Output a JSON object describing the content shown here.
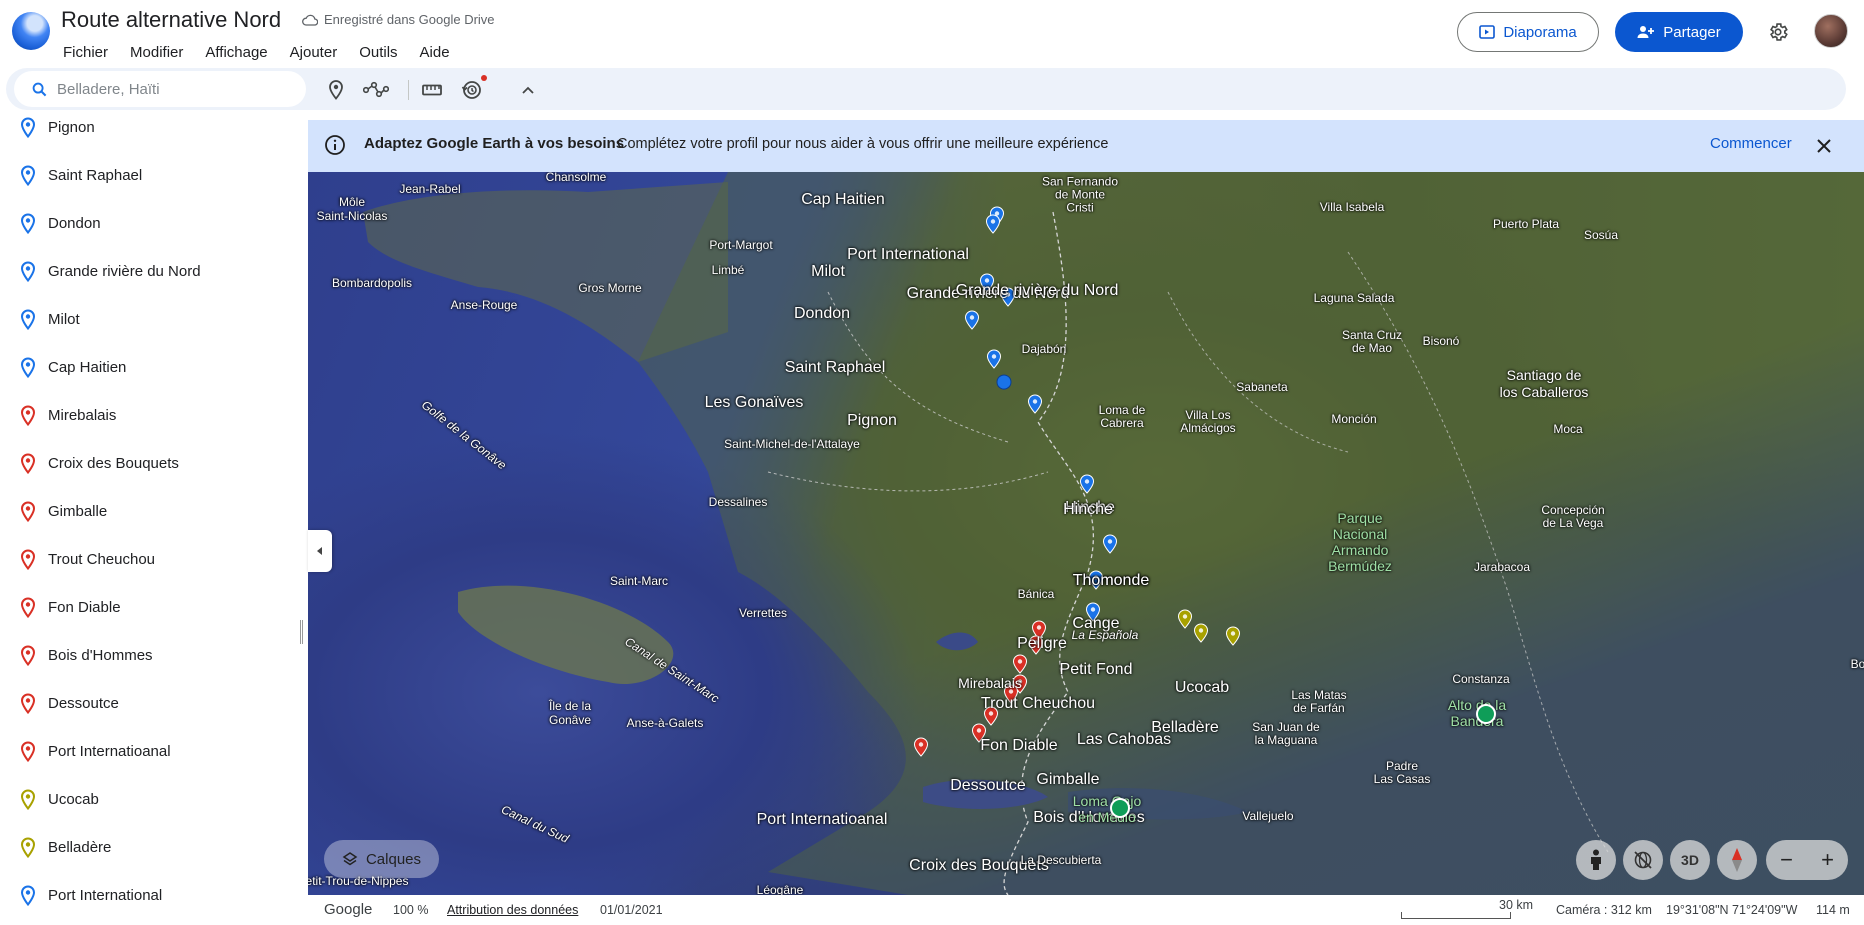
{
  "header": {
    "title": "Route alternative Nord",
    "drive_status": "Enregistré dans Google Drive",
    "menu": [
      "Fichier",
      "Modifier",
      "Affichage",
      "Ajouter",
      "Outils",
      "Aide"
    ],
    "slideshow_label": "Diaporama",
    "share_label": "Partager"
  },
  "toolbar": {
    "search_placeholder": "Belladere, Haïti"
  },
  "sidebar": {
    "items": [
      {
        "label": "Pignon",
        "color": "#1a73e8"
      },
      {
        "label": "Saint Raphael",
        "color": "#1a73e8"
      },
      {
        "label": "Dondon",
        "color": "#1a73e8"
      },
      {
        "label": "Grande rivière du Nord",
        "color": "#1a73e8"
      },
      {
        "label": "Milot",
        "color": "#1a73e8"
      },
      {
        "label": "Cap Haitien",
        "color": "#1a73e8"
      },
      {
        "label": "Mirebalais",
        "color": "#d93025"
      },
      {
        "label": "Croix des Bouquets",
        "color": "#d93025"
      },
      {
        "label": "Gimballe",
        "color": "#d93025"
      },
      {
        "label": "Trout Cheuchou",
        "color": "#d93025"
      },
      {
        "label": "Fon Diable",
        "color": "#d93025"
      },
      {
        "label": "Bois d'Hommes",
        "color": "#d93025"
      },
      {
        "label": "Dessoutce",
        "color": "#d93025"
      },
      {
        "label": "Port Internatioanal",
        "color": "#d93025"
      },
      {
        "label": "Ucocab",
        "color": "#a8a100"
      },
      {
        "label": "Belladère",
        "color": "#a8a100"
      },
      {
        "label": "Port International",
        "color": "#1a73e8"
      }
    ]
  },
  "banner": {
    "title": "Adaptez Google Earth à vos besoins",
    "text": "Complétez votre profil pour nous aider à vous offrir une meilleure expérience",
    "action": "Commencer"
  },
  "map": {
    "labels": {
      "jean_rabel": "Jean-Rabel",
      "mole": "Môle\nSaint-Nicolas",
      "chansolme": "Chansolme",
      "bombardopolis": "Bombardopolis",
      "anse_rouge": "Anse-Rouge",
      "gros_morne": "Gros Morne",
      "port_margot": "Port-Margot",
      "limbe": "Limbé",
      "cap_haitien": "Cap Haitien",
      "port_international": "Port International",
      "milot": "Milot",
      "grande_riviere": "Grande rivière du Nord",
      "dondon": "Dondon",
      "saint_raphael": "Saint Raphael",
      "pignon": "Pignon",
      "les_gonaives": "Les Gonaïves",
      "golfe_gonave": "Golfe de la Gonâve",
      "saint_michel": "Saint-Michel-de-l'Attalaye",
      "dessalines": "Dessalines",
      "hinche": "Hinche",
      "thomonde": "Thomonde",
      "saint_marc": "Saint-Marc",
      "verrettes": "Verrettes",
      "cange": "Cange",
      "peligre": "Peligre",
      "petit_fond": "Petit Fond",
      "mirebalais": "Mirebalais",
      "trout_cheuchou": "Trout Cheuchou",
      "ucocab": "Ucocab",
      "belladere": "Belladère",
      "las_cahobas": "Las Cahobas",
      "fon_diable": "Fon Diable",
      "dessoutce": "Dessoutce",
      "gimballe": "Gimballe",
      "port_internatioanal": "Port Internatioanal",
      "bois_dhommes": "Bois d'Hommes",
      "croix_bouquets": "Croix des Bouquets",
      "canal_saint_marc": "Canal de Saint-Marc",
      "ile_gonave": "Île de la\nGonâve",
      "anse_galets": "Anse-à-Galets",
      "canal_sud": "Canal du Sud",
      "petit_trou": "Petit-Trou-de-Nippes",
      "leogane": "Léogâne",
      "san_fernando": "San Fernando\nde Monte\nCristi",
      "villa_isabela": "Villa Isabela",
      "puerto_plata": "Puerto Plata",
      "sosua": "Sosúa",
      "dajabon": "Dajabón",
      "laguna_salada": "Laguna Salada",
      "santa_cruz": "Santa Cruz\nde Mao",
      "bisono": "Bisonó",
      "santiago": "Santiago de\nlos Caballeros",
      "loma_cabrera": "Loma de\nCabrera",
      "villa_los_almacigos": "Villa Los\nAlmácigos",
      "sabaneta": "Sabaneta",
      "moncion": "Monción",
      "moca": "Moca",
      "parque": "Parque\nNacional\nArmando\nBermúdez",
      "concepcion": "Concepción\nde La Vega",
      "jarabacoa": "Jarabacoa",
      "banica": "Bánica",
      "la_espanola": "La Española",
      "las_matas": "Las Matas\nde Farfán",
      "san_juan": "San Juan de\nla Maguana",
      "constanza": "Constanza",
      "alto_bandera": "Alto de la\nBandera",
      "padre_las_casas": "Padre\nLas Casas",
      "loma_gajo": "Loma Gajo\nen Medio",
      "vallejuelo": "Vallejuelo",
      "la_descubierta": "La Descubierta",
      "bo": "Bo"
    },
    "layers_label": "Calques",
    "ctl_3d": "3D"
  },
  "statusbar": {
    "brand": "Google",
    "zoom": "100 %",
    "attribution": "Attribution des données",
    "date": "01/01/2021",
    "scale": "30 km",
    "camera": "Caméra : 312 km",
    "coords": "19°31'08\"N 71°24'09\"W",
    "elevation": "114 m"
  }
}
